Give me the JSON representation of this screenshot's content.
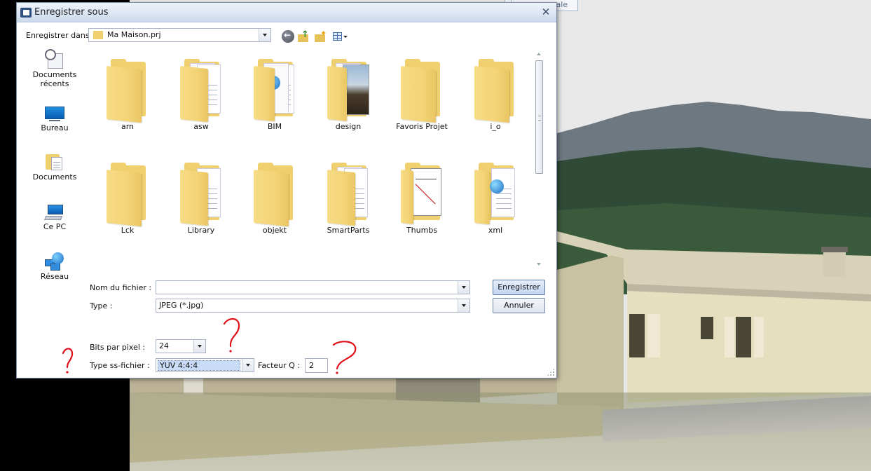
{
  "dialog": {
    "title": "Enregistrer sous",
    "close_glyph": "✕"
  },
  "background": {
    "tab_fragment": "rale"
  },
  "location": {
    "label": "Enregistrer dans :",
    "value": "Ma Maison.prj"
  },
  "toolbar": {
    "icons": [
      "back-icon",
      "up-folder-icon",
      "new-folder-icon",
      "view-menu-icon"
    ]
  },
  "places": [
    {
      "label": "Documents récents",
      "icon": "recent-documents-icon"
    },
    {
      "label": "Bureau",
      "icon": "desktop-icon"
    },
    {
      "label": "Documents",
      "icon": "documents-icon"
    },
    {
      "label": "Ce PC",
      "icon": "computer-icon"
    },
    {
      "label": "Réseau",
      "icon": "network-icon"
    }
  ],
  "files": [
    {
      "name": "arn",
      "icon": "folder-icon"
    },
    {
      "name": "asw",
      "icon": "folder-papers-icon"
    },
    {
      "name": "BIM",
      "icon": "folder-globe-icon"
    },
    {
      "name": "design",
      "icon": "folder-photo-icon"
    },
    {
      "name": "Favoris Projet",
      "icon": "folder-icon"
    },
    {
      "name": "i_o",
      "icon": "folder-icon"
    },
    {
      "name": "Lck",
      "icon": "folder-icon"
    },
    {
      "name": "Library",
      "icon": "folder-papers-icon"
    },
    {
      "name": "objekt",
      "icon": "folder-icon"
    },
    {
      "name": "SmartParts",
      "icon": "folder-papers-icon"
    },
    {
      "name": "Thumbs",
      "icon": "folder-sketch-icon"
    },
    {
      "name": "xml",
      "icon": "folder-globe-icon"
    }
  ],
  "form": {
    "filename_label": "Nom du fichier :",
    "filename_value": "",
    "type_label": "Type :",
    "type_value": "JPEG (*.jpg)",
    "bits_label": "Bits par pixel :",
    "bits_value": "24",
    "subtype_label": "Type ss-fichier :",
    "subtype_value": "YUV 4:4:4",
    "q_label": "Facteur Q :",
    "q_value": "2"
  },
  "buttons": {
    "save": "Enregistrer",
    "cancel": "Annuler"
  },
  "annotations": {
    "mark": "?",
    "color": "#e0101a"
  }
}
